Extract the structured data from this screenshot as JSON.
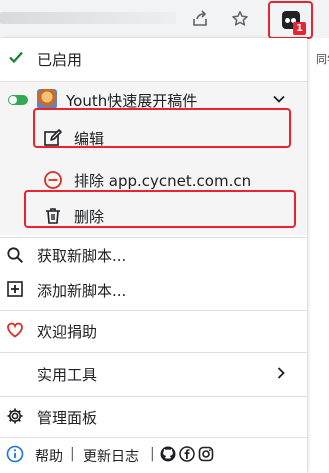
{
  "menu": {
    "enabled_label": "已启用",
    "script": {
      "name": "Youth快速展开稿件",
      "edit_label": "编辑",
      "exclude_label": "排除 app.cycnet.com.cn",
      "delete_label": "删除"
    },
    "get_new_script_label": "获取新脚本...",
    "add_new_script_label": "添加新脚本...",
    "donate_label": "欢迎捐助",
    "utilities_label": "实用工具",
    "dashboard_label": "管理面板",
    "help_label": "帮助",
    "changelog_label": "更新日志",
    "footer_separator": "|"
  },
  "extension": {
    "badge_count": "1"
  },
  "background": {
    "peek_text": "同学"
  },
  "colors": {
    "accent_red": "#e8242e",
    "toggle_green": "#34a853",
    "check_green": "#188038",
    "heart_red": "#d93025",
    "info_blue": "#1a73e8",
    "forbid_red": "#d93025"
  },
  "icons": {
    "share": "share-icon",
    "bookmark": "star-icon",
    "extension": "tampermonkey-icon",
    "check": "check-icon",
    "toggle": "toggle-switch",
    "chevron_down": "chevron-down-icon",
    "edit": "edit-icon",
    "exclude": "forbid-icon",
    "delete": "trash-icon",
    "search": "search-icon",
    "add": "add-box-icon",
    "heart": "heart-icon",
    "chevron_right": "chevron-right-icon",
    "settings": "gear-icon",
    "info": "info-icon",
    "github": "github-icon",
    "facebook": "facebook-icon",
    "instagram": "instagram-icon"
  }
}
